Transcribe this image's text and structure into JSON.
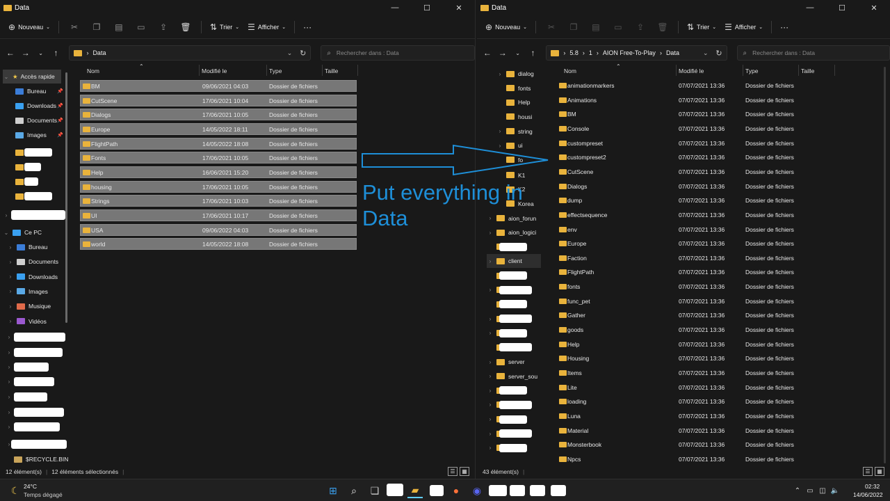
{
  "left_window": {
    "title": "Data",
    "toolbar": {
      "new_label": "Nouveau",
      "sort_label": "Trier",
      "view_label": "Afficher",
      "more_label": "···"
    },
    "address": {
      "crumbs": [
        "Data"
      ]
    },
    "search": {
      "placeholder": "Rechercher dans : Data"
    },
    "columns": {
      "name": "Nom",
      "modified": "Modifié le",
      "type": "Type",
      "size": "Taille"
    },
    "nav": {
      "quick_access": "Accès rapide",
      "items": [
        {
          "label": "Bureau"
        },
        {
          "label": "Downloads"
        },
        {
          "label": "Documents"
        },
        {
          "label": "Images"
        }
      ],
      "this_pc": "Ce PC",
      "pc_items": [
        {
          "label": "Bureau"
        },
        {
          "label": "Documents"
        },
        {
          "label": "Downloads"
        },
        {
          "label": "Images"
        },
        {
          "label": "Musique"
        },
        {
          "label": "Vidéos"
        }
      ],
      "recycle": "$RECYCLE.BIN"
    },
    "rows": [
      {
        "name": "BM",
        "modified": "09/06/2021 04:03",
        "type": "Dossier de fichiers"
      },
      {
        "name": "CutScene",
        "modified": "17/06/2021 10:04",
        "type": "Dossier de fichiers"
      },
      {
        "name": "Dialogs",
        "modified": "17/06/2021 10:05",
        "type": "Dossier de fichiers"
      },
      {
        "name": "Europe",
        "modified": "14/05/2022 18:11",
        "type": "Dossier de fichiers"
      },
      {
        "name": "FlightPath",
        "modified": "14/05/2022 18:08",
        "type": "Dossier de fichiers"
      },
      {
        "name": "Fonts",
        "modified": "17/06/2021 10:05",
        "type": "Dossier de fichiers"
      },
      {
        "name": "Help",
        "modified": "16/06/2021 15:20",
        "type": "Dossier de fichiers"
      },
      {
        "name": "housing",
        "modified": "17/06/2021 10:05",
        "type": "Dossier de fichiers"
      },
      {
        "name": "Strings",
        "modified": "17/06/2021 10:03",
        "type": "Dossier de fichiers"
      },
      {
        "name": "UI",
        "modified": "17/06/2021 10:17",
        "type": "Dossier de fichiers"
      },
      {
        "name": "USA",
        "modified": "09/06/2022 04:03",
        "type": "Dossier de fichiers"
      },
      {
        "name": "world",
        "modified": "14/05/2022 18:08",
        "type": "Dossier de fichiers"
      }
    ],
    "status": {
      "count": "12 élément(s)",
      "selected": "12 éléments sélectionnés"
    }
  },
  "right_window": {
    "title": "Data",
    "toolbar": {
      "new_label": "Nouveau",
      "sort_label": "Trier",
      "view_label": "Afficher",
      "more_label": "···"
    },
    "address": {
      "crumbs": [
        "5.8",
        "1",
        "AION Free-To-Play",
        "Data"
      ]
    },
    "search": {
      "placeholder": "Rechercher dans : Data"
    },
    "columns": {
      "name": "Nom",
      "modified": "Modifié le",
      "type": "Type",
      "size": "Taille"
    },
    "nav_tree": [
      {
        "label": "dialog",
        "redacted": false
      },
      {
        "label": "fonts",
        "redacted": false
      },
      {
        "label": "Help",
        "redacted": false
      },
      {
        "label": "housi",
        "redacted": false
      },
      {
        "label": "string",
        "redacted": false
      },
      {
        "label": "ui",
        "redacted": false
      },
      {
        "label": "fo",
        "redacted": false
      },
      {
        "label": "K1",
        "redacted": false
      },
      {
        "label": "K2",
        "redacted": false
      },
      {
        "label": "Korea",
        "redacted": false
      },
      {
        "label": "aion_forun",
        "redacted": false
      },
      {
        "label": "aion_logici",
        "redacted": false
      },
      {
        "label": "",
        "redacted": true
      },
      {
        "label": "client",
        "redacted": false
      },
      {
        "label": "",
        "redacted": true
      },
      {
        "label": "",
        "redacted": true
      },
      {
        "label": "",
        "redacted": true
      },
      {
        "label": "",
        "redacted": true
      },
      {
        "label": "",
        "redacted": true
      },
      {
        "label": "",
        "redacted": true
      },
      {
        "label": "server",
        "redacted": false
      },
      {
        "label": "server_sou",
        "redacted": false
      },
      {
        "label": "",
        "redacted": true
      },
      {
        "label": "",
        "redacted": true
      },
      {
        "label": "",
        "redacted": true
      },
      {
        "label": "",
        "redacted": true
      },
      {
        "label": "",
        "redacted": true
      }
    ],
    "rows": [
      {
        "name": "animationmarkers",
        "modified": "07/07/2021 13:36",
        "type": "Dossier de fichiers"
      },
      {
        "name": "Animations",
        "modified": "07/07/2021 13:36",
        "type": "Dossier de fichiers"
      },
      {
        "name": "BM",
        "modified": "07/07/2021 13:36",
        "type": "Dossier de fichiers"
      },
      {
        "name": "Console",
        "modified": "07/07/2021 13:36",
        "type": "Dossier de fichiers"
      },
      {
        "name": "custompreset",
        "modified": "07/07/2021 13:36",
        "type": "Dossier de fichiers"
      },
      {
        "name": "custompreset2",
        "modified": "07/07/2021 13:36",
        "type": "Dossier de fichiers"
      },
      {
        "name": "CutScene",
        "modified": "07/07/2021 13:36",
        "type": "Dossier de fichiers"
      },
      {
        "name": "Dialogs",
        "modified": "07/07/2021 13:36",
        "type": "Dossier de fichiers"
      },
      {
        "name": "dump",
        "modified": "07/07/2021 13:36",
        "type": "Dossier de fichiers"
      },
      {
        "name": "effectsequence",
        "modified": "07/07/2021 13:36",
        "type": "Dossier de fichiers"
      },
      {
        "name": "env",
        "modified": "07/07/2021 13:36",
        "type": "Dossier de fichiers"
      },
      {
        "name": "Europe",
        "modified": "07/07/2021 13:36",
        "type": "Dossier de fichiers"
      },
      {
        "name": "Faction",
        "modified": "07/07/2021 13:36",
        "type": "Dossier de fichiers"
      },
      {
        "name": "FlightPath",
        "modified": "07/07/2021 13:36",
        "type": "Dossier de fichiers"
      },
      {
        "name": "fonts",
        "modified": "07/07/2021 13:36",
        "type": "Dossier de fichiers"
      },
      {
        "name": "func_pet",
        "modified": "07/07/2021 13:36",
        "type": "Dossier de fichiers"
      },
      {
        "name": "Gather",
        "modified": "07/07/2021 13:36",
        "type": "Dossier de fichiers"
      },
      {
        "name": "goods",
        "modified": "07/07/2021 13:36",
        "type": "Dossier de fichiers"
      },
      {
        "name": "Help",
        "modified": "07/07/2021 13:36",
        "type": "Dossier de fichiers"
      },
      {
        "name": "Housing",
        "modified": "07/07/2021 13:36",
        "type": "Dossier de fichiers"
      },
      {
        "name": "Items",
        "modified": "07/07/2021 13:36",
        "type": "Dossier de fichiers"
      },
      {
        "name": "Lite",
        "modified": "07/07/2021 13:36",
        "type": "Dossier de fichiers"
      },
      {
        "name": "loading",
        "modified": "07/07/2021 13:36",
        "type": "Dossier de fichiers"
      },
      {
        "name": "Luna",
        "modified": "07/07/2021 13:36",
        "type": "Dossier de fichiers"
      },
      {
        "name": "Material",
        "modified": "07/07/2021 13:36",
        "type": "Dossier de fichiers"
      },
      {
        "name": "Monsterbook",
        "modified": "07/07/2021 13:36",
        "type": "Dossier de fichiers"
      },
      {
        "name": "Npcs",
        "modified": "07/07/2021 13:36",
        "type": "Dossier de fichiers"
      }
    ],
    "status": {
      "count": "43 élément(s)"
    }
  },
  "annotation": {
    "text": "Put everything in\nData",
    "color": "#1e8fd8"
  },
  "taskbar": {
    "weather_temp": "24°C",
    "weather_desc": "Temps dégagé",
    "time": "02:32",
    "date": "14/06/2022"
  }
}
